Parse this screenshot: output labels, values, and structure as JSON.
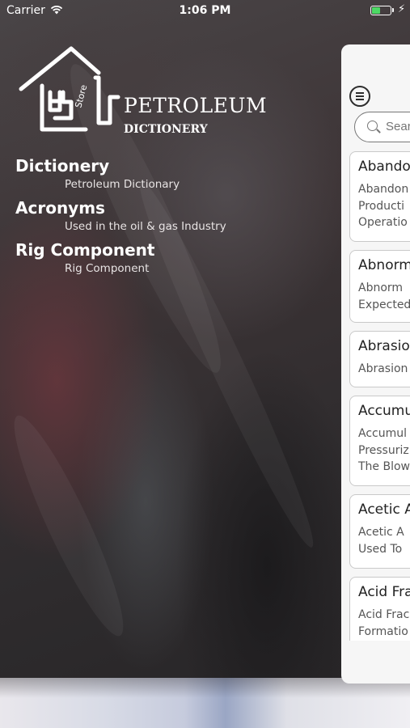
{
  "status_bar": {
    "carrier": "Carrier",
    "time": "1:06 PM",
    "battery_level": 0.45,
    "battery_color": "#4cd964"
  },
  "logo": {
    "title": "PETROLEUM",
    "subtitle": "DICTIONERY",
    "badge": "Store"
  },
  "menu": {
    "items": [
      {
        "title": "Dictionery",
        "subtitle": "Petroleum Dictionary"
      },
      {
        "title": "Acronyms",
        "subtitle": "Used in the oil & gas Industry"
      },
      {
        "title": "Rig Component",
        "subtitle": "Rig Component"
      }
    ]
  },
  "panel": {
    "menu_icon": "hamburger-icon",
    "search_placeholder": "Search",
    "cards": [
      {
        "title": "Abandon",
        "lines": [
          "Abandon",
          "Producti",
          "Operatio"
        ]
      },
      {
        "title": "Abnorma",
        "lines": [
          "Abnorm",
          "Expected"
        ]
      },
      {
        "title": "Abrasion",
        "lines": [
          "Abrasion"
        ]
      },
      {
        "title": "Accumula",
        "lines": [
          "Accumul",
          "Pressuriz",
          "The Blow"
        ]
      },
      {
        "title": "Acetic A",
        "lines": [
          "Acetic A",
          "Used To"
        ]
      },
      {
        "title": "Acid Fra",
        "lines": [
          "Acid Frac",
          "Formatio"
        ]
      }
    ]
  }
}
